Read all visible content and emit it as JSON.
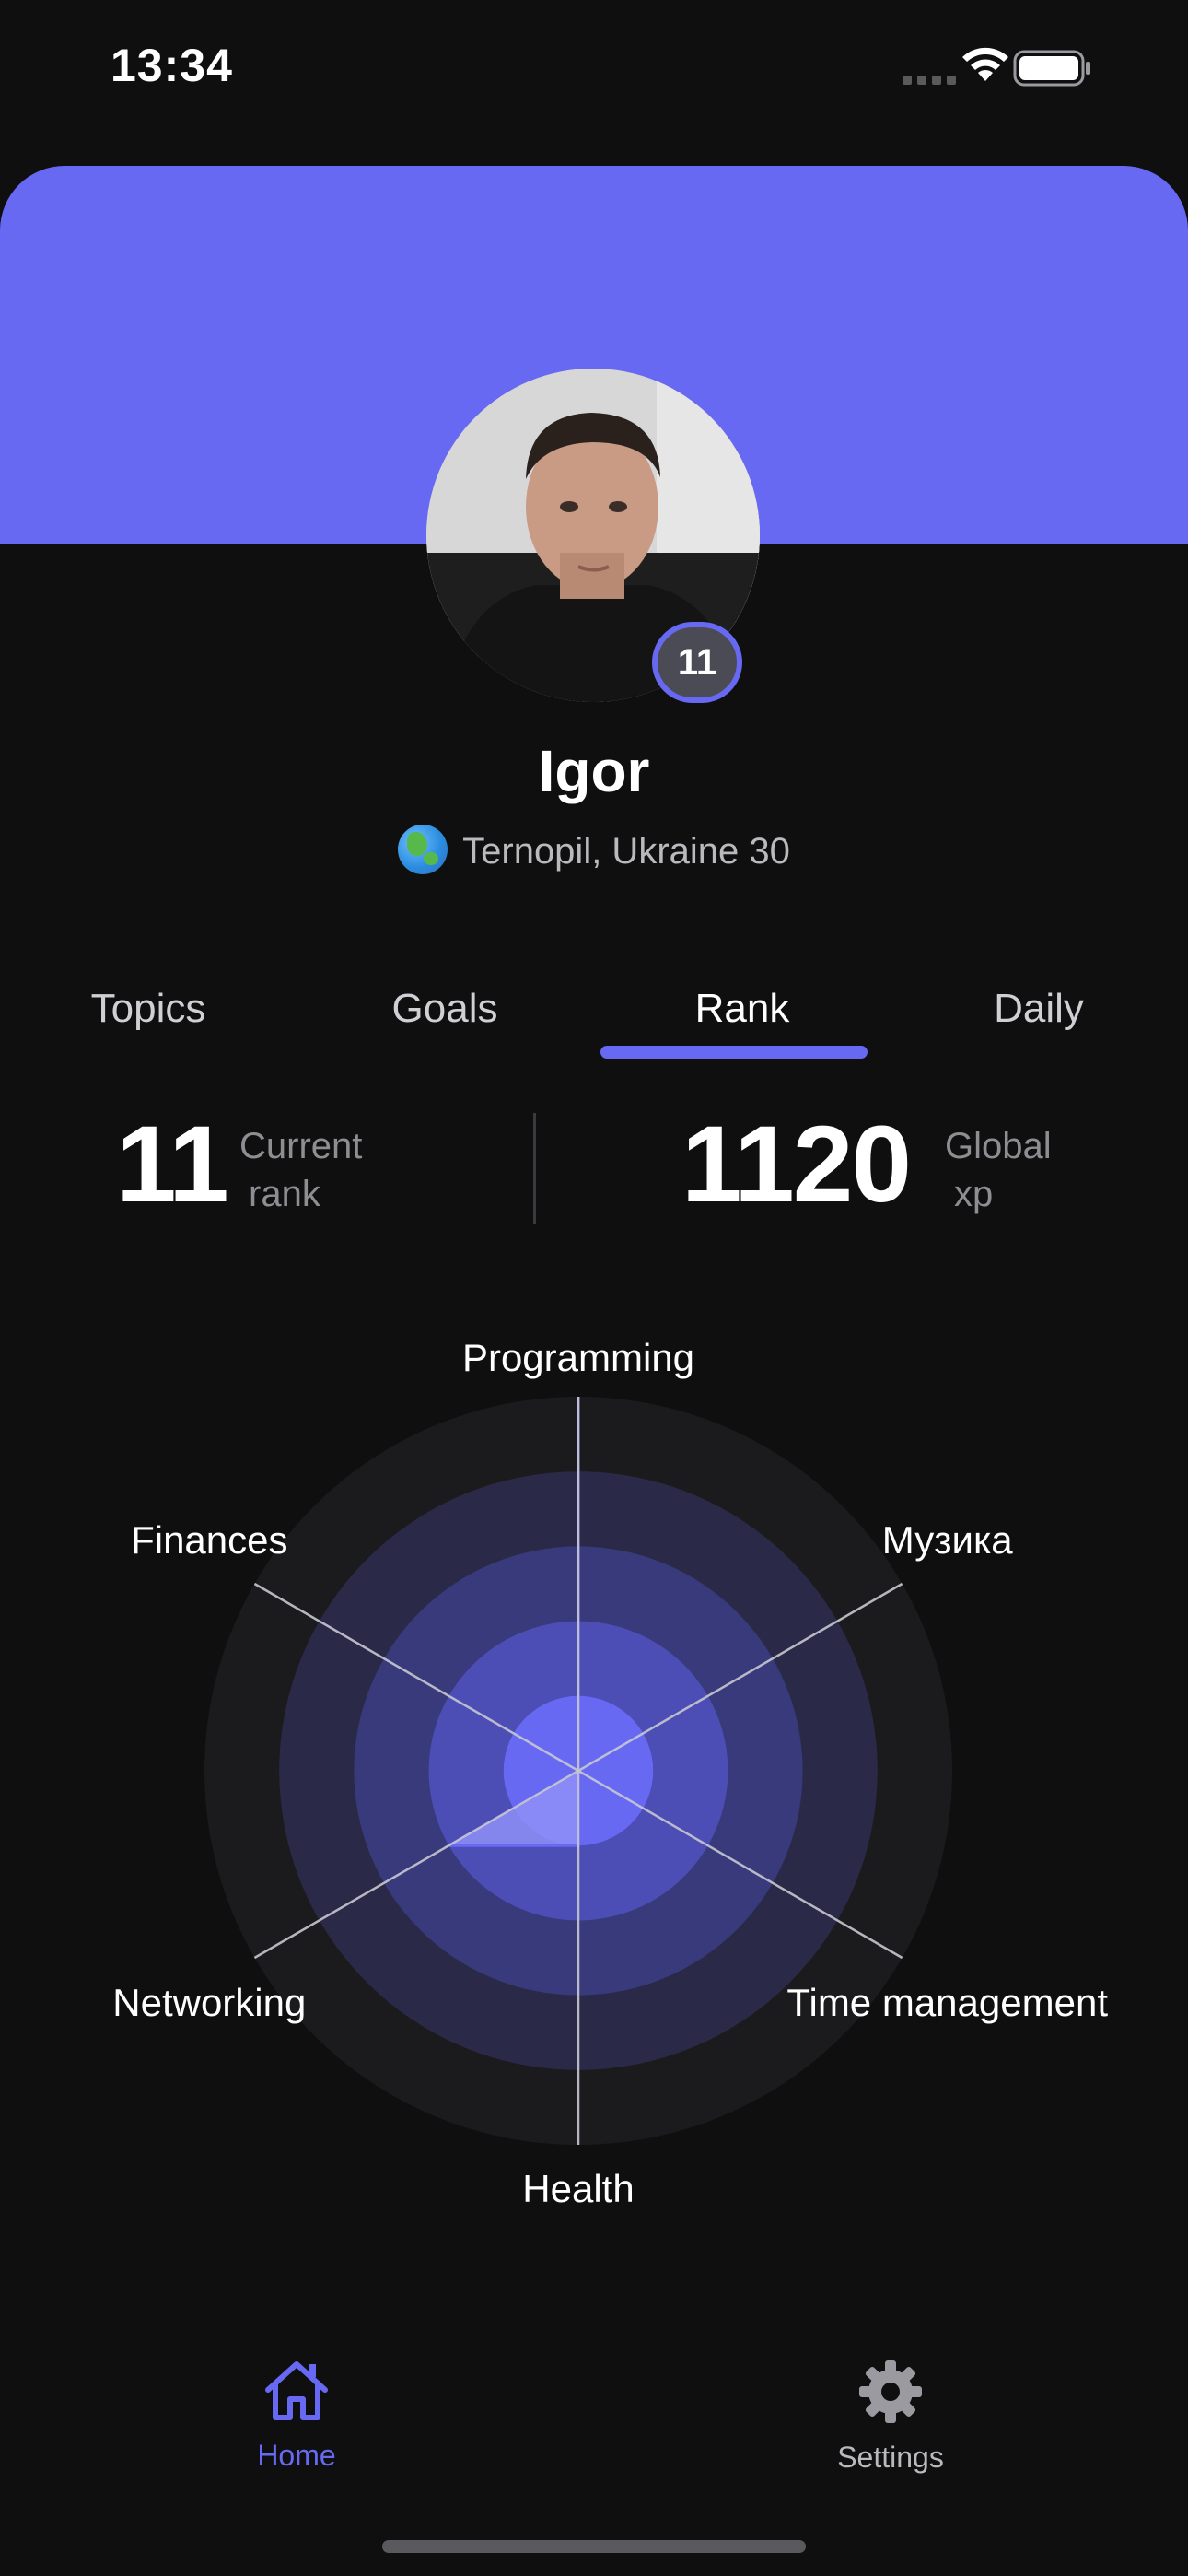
{
  "status_bar": {
    "time": "13:34"
  },
  "profile": {
    "name": "Igor",
    "location": "Ternopil, Ukraine 30",
    "rank_badge": "11"
  },
  "tabs": [
    {
      "label": "Topics",
      "active": false
    },
    {
      "label": "Goals",
      "active": false
    },
    {
      "label": "Rank",
      "active": true
    },
    {
      "label": "Daily",
      "active": false
    }
  ],
  "stats": {
    "rank": {
      "value": "11",
      "label_line1": "Current",
      "label_line2": "rank"
    },
    "xp": {
      "value": "1120",
      "label_line1": "Global",
      "label_line2": "xp"
    }
  },
  "chart_data": {
    "type": "radar",
    "categories": [
      "Programming",
      "Музика",
      "Time management",
      "Health",
      "Networking",
      "Finances"
    ],
    "rings": 5,
    "max": 5,
    "series": [
      {
        "values": [
          5,
          0,
          0,
          1,
          2,
          0
        ]
      }
    ],
    "colors": {
      "fill": "#8f90f7",
      "stroke": "#6869f3",
      "axis": "#c8c8d0"
    }
  },
  "bottom_nav": {
    "home_label": "Home",
    "settings_label": "Settings"
  },
  "colors": {
    "accent": "#6869f3",
    "background": "#0f0f10"
  }
}
